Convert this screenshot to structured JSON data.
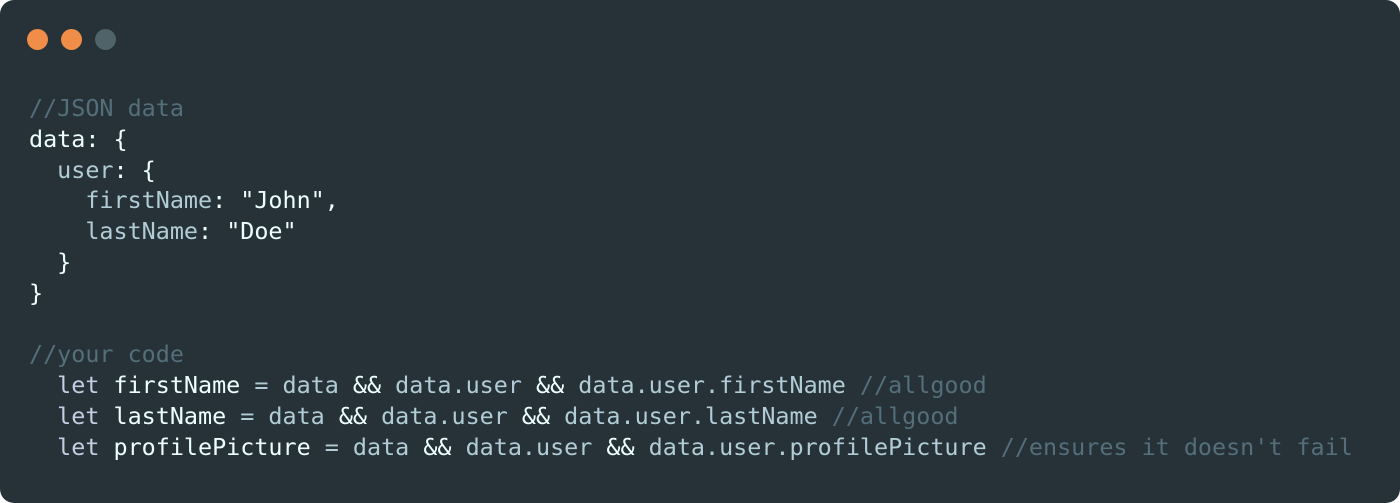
{
  "window": {
    "dots": [
      {
        "name": "close",
        "color": "#f08d49"
      },
      {
        "name": "minimize",
        "color": "#f08d49"
      },
      {
        "name": "maximize",
        "color": "#4e6469"
      }
    ]
  },
  "code": {
    "lines": [
      {
        "parts": [
          {
            "t": "//JSON data",
            "k": "c"
          }
        ]
      },
      {
        "parts": [
          {
            "t": "data",
            "k": "w"
          },
          {
            "t": ": {",
            "k": "w"
          }
        ]
      },
      {
        "parts": [
          {
            "t": "  ",
            "k": "w"
          },
          {
            "t": "user",
            "k": "prop"
          },
          {
            "t": ": {",
            "k": "w"
          }
        ]
      },
      {
        "parts": [
          {
            "t": "    ",
            "k": "w"
          },
          {
            "t": "firstName",
            "k": "prop"
          },
          {
            "t": ": ",
            "k": "w"
          },
          {
            "t": "\"John\"",
            "k": "s"
          },
          {
            "t": ",",
            "k": "w"
          }
        ]
      },
      {
        "parts": [
          {
            "t": "    ",
            "k": "w"
          },
          {
            "t": "lastName",
            "k": "prop"
          },
          {
            "t": ": ",
            "k": "w"
          },
          {
            "t": "\"Doe\"",
            "k": "s"
          }
        ]
      },
      {
        "parts": [
          {
            "t": "  }",
            "k": "w"
          }
        ]
      },
      {
        "parts": [
          {
            "t": "}",
            "k": "w"
          }
        ]
      },
      {
        "parts": [
          {
            "t": "",
            "k": "w"
          }
        ]
      },
      {
        "parts": [
          {
            "t": "//your code",
            "k": "c"
          }
        ]
      },
      {
        "parts": [
          {
            "t": "  ",
            "k": "w"
          },
          {
            "t": "let",
            "k": "let"
          },
          {
            "t": " firstName ",
            "k": "w"
          },
          {
            "t": "=",
            "k": "prop"
          },
          {
            "t": " data ",
            "k": "prop"
          },
          {
            "t": "&&",
            "k": "w"
          },
          {
            "t": " data.user ",
            "k": "prop"
          },
          {
            "t": "&&",
            "k": "w"
          },
          {
            "t": " data.user.firstName ",
            "k": "prop"
          },
          {
            "t": "//allgood",
            "k": "c"
          }
        ]
      },
      {
        "parts": [
          {
            "t": "  ",
            "k": "w"
          },
          {
            "t": "let",
            "k": "let"
          },
          {
            "t": " lastName ",
            "k": "w"
          },
          {
            "t": "=",
            "k": "prop"
          },
          {
            "t": " data ",
            "k": "prop"
          },
          {
            "t": "&&",
            "k": "w"
          },
          {
            "t": " data.user ",
            "k": "prop"
          },
          {
            "t": "&&",
            "k": "w"
          },
          {
            "t": " data.user.lastName ",
            "k": "prop"
          },
          {
            "t": "//allgood",
            "k": "c"
          }
        ]
      },
      {
        "parts": [
          {
            "t": "  ",
            "k": "w"
          },
          {
            "t": "let",
            "k": "let"
          },
          {
            "t": " profilePicture ",
            "k": "w"
          },
          {
            "t": "=",
            "k": "prop"
          },
          {
            "t": " data ",
            "k": "prop"
          },
          {
            "t": "&&",
            "k": "w"
          },
          {
            "t": " data.user ",
            "k": "prop"
          },
          {
            "t": "&&",
            "k": "w"
          },
          {
            "t": " data.user.profilePicture ",
            "k": "prop"
          },
          {
            "t": "//ensures it doesn't fail",
            "k": "c"
          }
        ]
      }
    ]
  }
}
